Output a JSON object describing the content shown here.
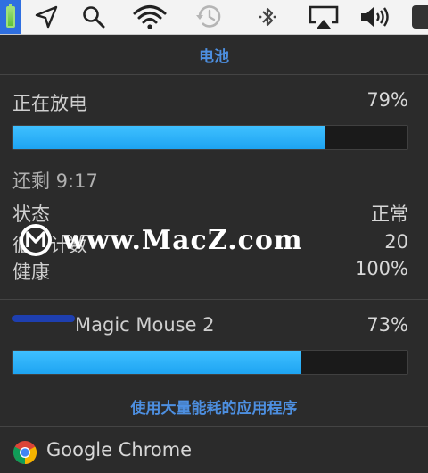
{
  "menubar": {
    "items": [
      {
        "name": "battery-icon"
      },
      {
        "name": "location-arrow-icon"
      },
      {
        "name": "search-icon"
      },
      {
        "name": "wifi-icon"
      },
      {
        "name": "time-machine-icon"
      },
      {
        "name": "bluetooth-icon"
      },
      {
        "name": "airplay-icon"
      },
      {
        "name": "volume-icon"
      }
    ]
  },
  "battery": {
    "title": "电池",
    "status_label": "正在放电",
    "percent": "79%",
    "level": 0.79,
    "remaining": "还剩 9:17",
    "rows": [
      {
        "label": "状态",
        "value": "正常"
      },
      {
        "label": "循环计数",
        "value": "20"
      },
      {
        "label": "健康",
        "value": "100%"
      }
    ]
  },
  "mouse": {
    "name": "Magic Mouse 2",
    "percent": "73%",
    "level": 0.73
  },
  "energy": {
    "heading": "使用大量能耗的应用程序",
    "apps": [
      {
        "name": "Google Chrome",
        "icon": "chrome-icon"
      }
    ]
  },
  "watermark": {
    "text": "www.MacZ.com"
  },
  "colors": {
    "accent": "#4d8fe0",
    "bar": "#1ea4f2",
    "panel": "#2b2b2b"
  }
}
